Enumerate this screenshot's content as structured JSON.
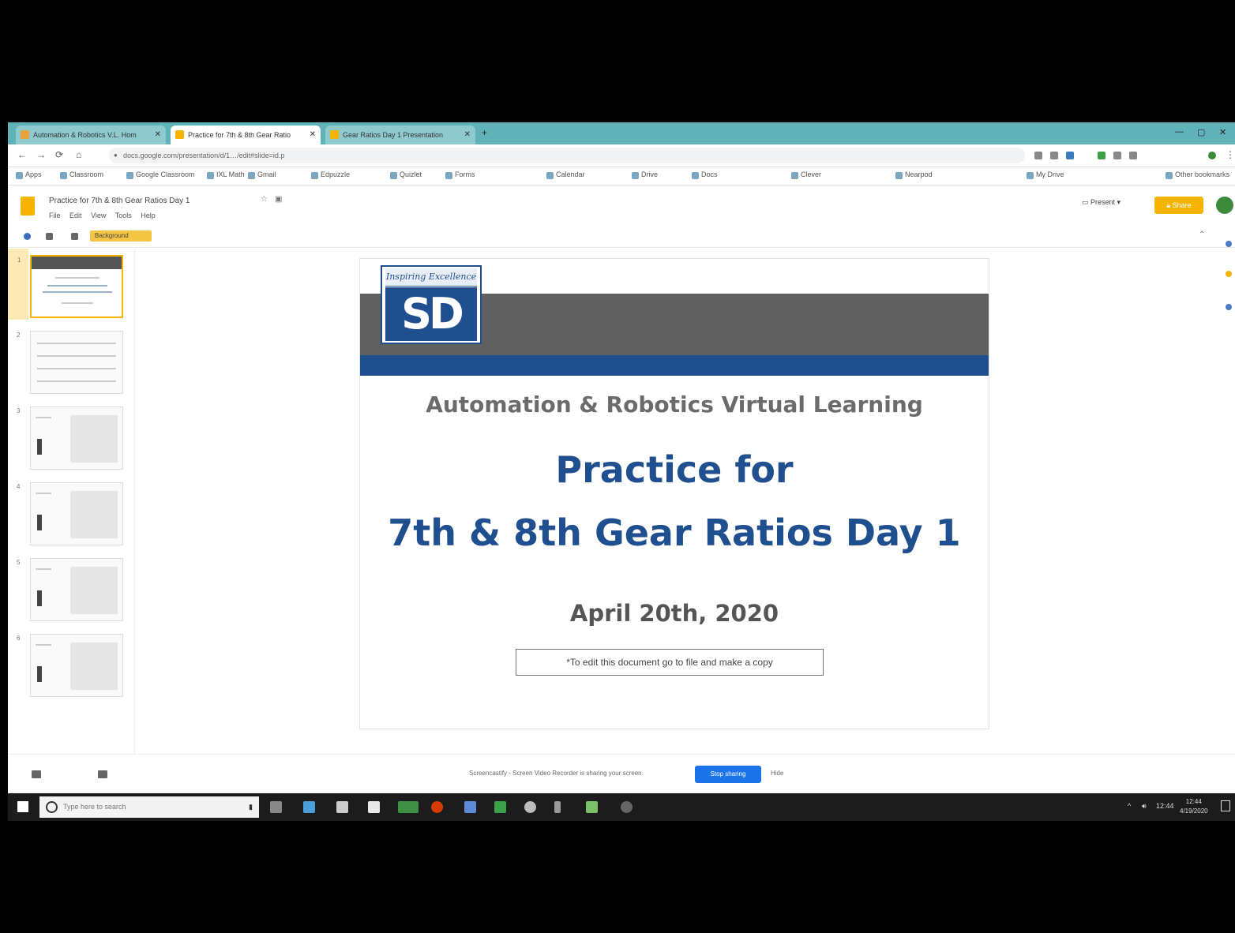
{
  "browser": {
    "tabs": [
      {
        "label": "Automation & Robotics V.L. Hom"
      },
      {
        "label": "Practice for 7th & 8th Gear Ratio"
      },
      {
        "label": "Gear Ratios Day 1 Presentation"
      }
    ],
    "new_tab_label": "+",
    "address": "docs.google.com/presentation/d/1…/edit#slide=id.p",
    "bookmarks": [
      "Apps",
      "Classroom",
      "Google Classroom",
      "IXL Math",
      "Gmail",
      "Edpuzzle",
      "Quizlet",
      "Forms",
      "Calendar",
      "Drive",
      "Docs",
      "Clever",
      "Nearpod",
      "My Drive"
    ],
    "other_bookmarks": "Other bookmarks"
  },
  "app": {
    "doc_title": "Practice for 7th & 8th Gear Ratios Day 1",
    "menus": [
      "File",
      "Edit",
      "View",
      "Tools",
      "Help"
    ],
    "present_label": "Present",
    "share_label": "Share",
    "toolbar_chip": "Background"
  },
  "slide": {
    "logo_script": "Inspiring Excellence",
    "logo_mark": "SD",
    "subtitle": "Automation & Robotics Virtual Learning",
    "title_line1": "Practice for",
    "title_line2": "7th & 8th Gear Ratios Day 1",
    "date": "April 20th, 2020",
    "note": "*To edit this document go to file and make a copy"
  },
  "filmstrip": {
    "numbers": [
      "1",
      "2",
      "3",
      "4",
      "5",
      "6"
    ]
  },
  "share_bar": {
    "message": "Screencastify - Screen Video Recorder is sharing your screen.",
    "stop_label": "Stop sharing",
    "hide_label": "Hide"
  },
  "taskbar": {
    "search_placeholder": "Type here to search",
    "time": "12:44",
    "date": "4/19/2020"
  },
  "colors": {
    "accent_blue": "#1f4f8f",
    "banner_grey": "#606060",
    "share_yellow": "#f4b400",
    "tabbar_teal": "#5fb3b8"
  }
}
